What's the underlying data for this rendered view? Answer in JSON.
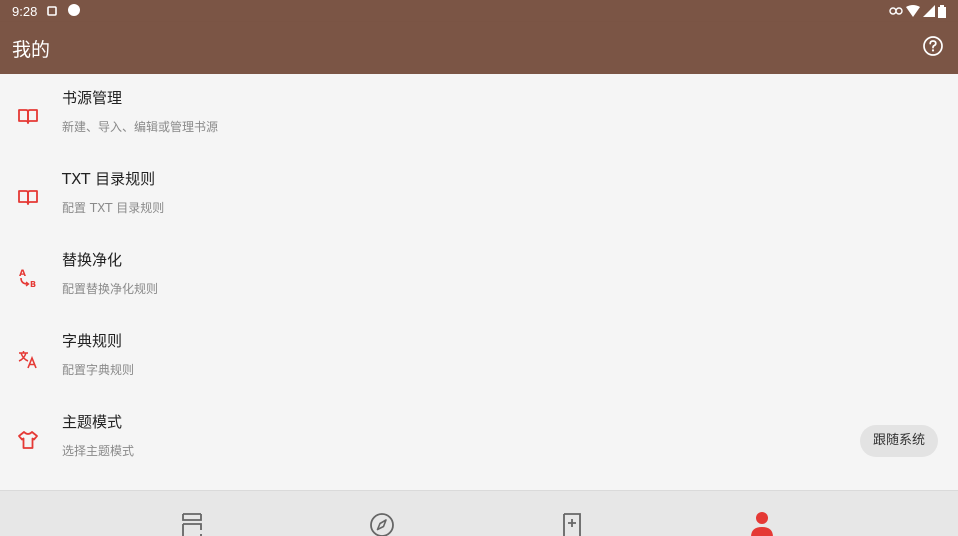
{
  "status_bar": {
    "time": "9:28"
  },
  "app_bar": {
    "title": "我的"
  },
  "preferences": [
    {
      "title": "书源管理",
      "summary": "新建、导入、编辑或管理书源",
      "icon": "book-open-icon"
    },
    {
      "title": "TXT 目录规则",
      "summary": "配置 TXT 目录规则",
      "icon": "book-open-icon"
    },
    {
      "title": "替换净化",
      "summary": "配置替换净化规则",
      "icon": "find-replace-icon"
    },
    {
      "title": "字典规则",
      "summary": "配置字典规则",
      "icon": "translate-icon"
    },
    {
      "title": "主题模式",
      "summary": "选择主题模式",
      "value": "跟随系统",
      "icon": "tshirt-icon"
    }
  ],
  "bottom_nav": {
    "items": [
      {
        "name": "bookshelf",
        "icon": "bookshelf-icon",
        "selected": false
      },
      {
        "name": "explore",
        "icon": "compass-icon",
        "selected": false
      },
      {
        "name": "rss",
        "icon": "bookmark-plus-icon",
        "selected": false
      },
      {
        "name": "my",
        "icon": "person-icon",
        "selected": true
      }
    ]
  },
  "colors": {
    "primary": "#7b5545",
    "accent": "#e53935",
    "background": "#f5f5f5",
    "nav_background": "#e7e7e7"
  }
}
